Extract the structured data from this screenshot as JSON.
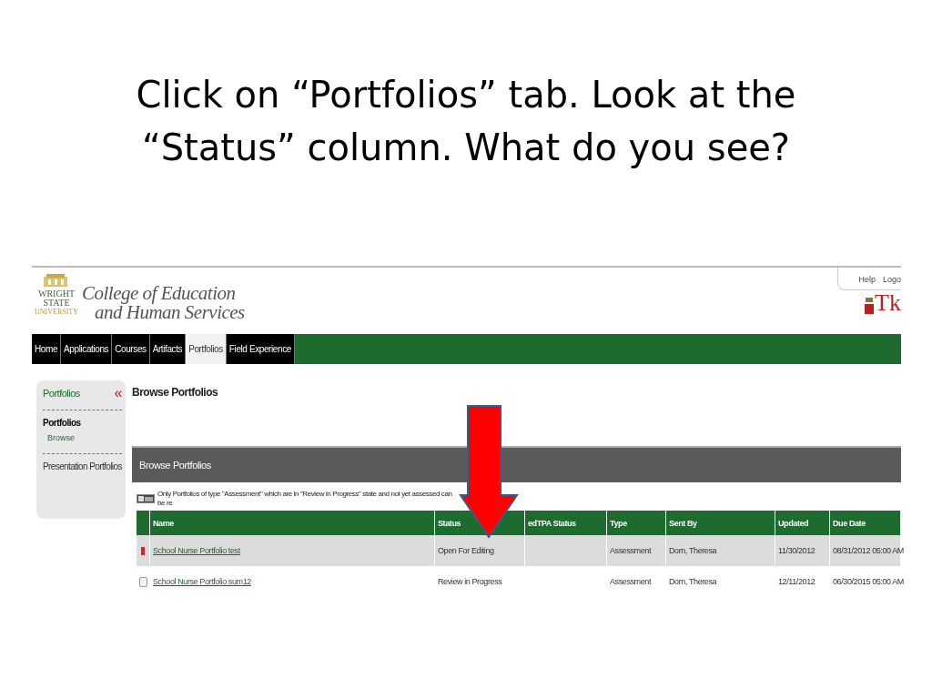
{
  "slide": {
    "title_lines": [
      "Click on “Portfolios” tab.  Look at the",
      "“Status” column.  What do you see?"
    ]
  },
  "header": {
    "logo_lines": [
      "WRIGHT",
      "STATE",
      "UNIVERSITY"
    ],
    "college_lines": [
      "College of Education",
      "and Human Services"
    ],
    "links": [
      "Help",
      "Logo"
    ],
    "brand": "Tk"
  },
  "nav_tabs": [
    {
      "label": "Home",
      "selected": false
    },
    {
      "label": "Applications",
      "selected": false
    },
    {
      "label": "Courses",
      "selected": false
    },
    {
      "label": "Artifacts",
      "selected": false
    },
    {
      "label": "Portfolios",
      "selected": true
    },
    {
      "label": "Field Experience",
      "selected": false
    }
  ],
  "sidebar": {
    "title": "Portfolios",
    "collapse_glyph": "«",
    "section": "Portfolios",
    "items": [
      "Browse"
    ],
    "other": "Presentation Portfolios"
  },
  "page_title": "Browse Portfolios",
  "panel": {
    "title": "Browse Portfolios",
    "note": "Only Portfolios of type \"Assessment\" which are in \"Review in Progress\" state and not yet assessed can be re"
  },
  "table": {
    "columns": [
      "Name",
      "Status",
      "edTPA Status",
      "Type",
      "Sent By",
      "Updated",
      "Due Date"
    ],
    "rows": [
      {
        "selected": true,
        "cells": [
          "School Nurse Portfolio test",
          "Open For Editing",
          "",
          "Assessment",
          "Dorn, Theresa",
          "11/30/2012",
          "08/31/2012 05:00 AM"
        ]
      },
      {
        "selected": false,
        "cells": [
          "School Nurse Portfolio sum12",
          "Review in Progress",
          "",
          "Assessment",
          "Dorn, Theresa",
          "12/11/2012",
          "06/30/2015 05:00 AM"
        ]
      }
    ]
  }
}
